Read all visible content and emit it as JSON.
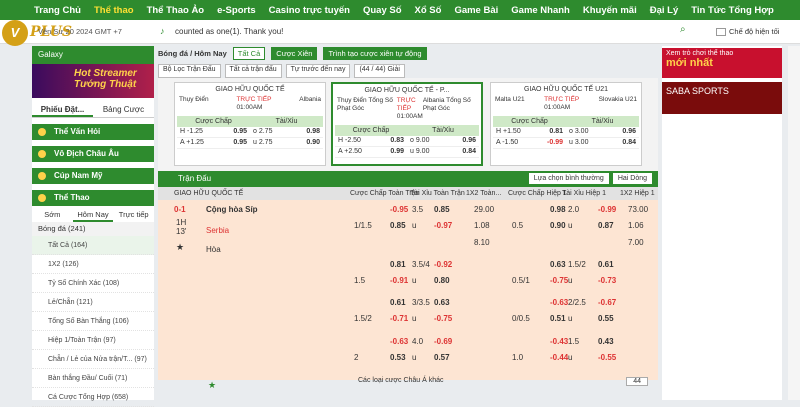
{
  "nav": [
    "Trang Chủ",
    "Thể thao",
    "Thể Thao Ảo",
    "e-Sports",
    "Casino trực tuyến",
    "Quay Số",
    "Xổ Số",
    "Game Bài",
    "Game Nhanh",
    "Khuyến mãi",
    "Đại Lý",
    "Tin Tức Tổng Hợp"
  ],
  "brand": {
    "initials": "V",
    "name": "PLUS"
  },
  "date_text": "Vên Sư 20 2024 GMT +7",
  "ticker": "counted as one(1). Thank you!",
  "toggle_label": "Chế độ hiện tối",
  "left": {
    "galaxy": "Galaxy",
    "banner": [
      "Hot Streamer",
      "Tướng Thuật"
    ],
    "tabs": [
      "Phiếu Đặt...",
      "Bảng Cược"
    ],
    "sections": [
      "Thể Vấn Hỏi",
      "Vô Địch Châu Âu",
      "Cúp Nam Mỹ",
      "Thể Thao"
    ],
    "sport_tabs": [
      "Sớm",
      "Hôm Nay",
      "Trực tiếp"
    ],
    "sport": "Bóng đá (241)",
    "items": [
      "Tất Cả (164)",
      "1X2 (126)",
      "Tỷ Số Chính Xác (108)",
      "Lẻ/Chẵn (121)",
      "Tổng Số Bàn Thắng (106)",
      "Hiệp 1/Toàn Trận (97)",
      "Chẵn / Lẻ của Nửa trận/T... (97)",
      "Bàn thắng Đầu/ Cuối (71)",
      "Cá Cược Tổng Hợp (658)"
    ]
  },
  "crumb": {
    "title": "Bóng đá / Hôm Nay",
    "select": "Tất Cả",
    "btn1": "Cược Xiên",
    "btn2": "Trình tạo cược xiên tự động"
  },
  "filters": [
    "Bộ Lọc Trận Đấu",
    "Tất cả trận đấu",
    "Tự trước đến nay",
    "(44 / 44) Giải"
  ],
  "cards": [
    {
      "league": "GIAO HỮU QUỐC TẾ",
      "home": "Thụy Điển",
      "away": "Albania",
      "live": "TRỰC TIẾP",
      "time": "01:00AM",
      "h": [
        "H -1.25",
        "0.95",
        "o 2.75",
        "0.98"
      ],
      "a": [
        "A +1.25",
        "0.95",
        "u 2.75",
        "0.90"
      ]
    },
    {
      "league": "GIAO HỮU QUỐC TẾ - P...",
      "home": "Thụy Điển Tổng Số Phạt Góc",
      "away": "Albania Tổng Số Phạt Góc",
      "live": "TRỰC TIẾP",
      "time": "01:00AM",
      "h": [
        "H -2.50",
        "0.83",
        "o 9.00",
        "0.96"
      ],
      "a": [
        "A +2.50",
        "0.99",
        "u 9.00",
        "0.84"
      ]
    },
    {
      "league": "GIAO HỮU QUỐC TẾ U21",
      "home": "Malta U21",
      "away": "Slovakia U21",
      "live": "TRỰC TIẾP",
      "time": "01:00AM",
      "h": [
        "H +1.50",
        "0.81",
        "o 3.00",
        "0.96"
      ],
      "a": [
        "A -1.50",
        "-0.99",
        "u 3.00",
        "0.84"
      ]
    }
  ],
  "card_head": [
    "Cược Chấp",
    "Tài/Xỉu"
  ],
  "table": {
    "title": "Trận Đấu",
    "right_btns": [
      "Lựa chọn bình thường",
      "Hai Dòng"
    ],
    "head": [
      "GIAO HỮU QUỐC TẾ",
      "Cược Chấp Toàn Trận",
      "Tài Xỉu Toàn Trận",
      "1X2 Toàn...",
      "Cược Chấp Hiệp 1",
      "Tài Xỉu Hiệp 1",
      "1X2 Hiệp 1"
    ],
    "match": {
      "score": "0-1",
      "time": "1H 13'",
      "home": "Cộng hòa Síp",
      "away": "Serbia",
      "draw": "Hòa"
    },
    "rows": [
      [
        "",
        "-0.95",
        "3.5",
        "0.85",
        "29.00",
        "",
        "0.98",
        "2.0",
        "-0.99",
        "73.00"
      ],
      [
        "1/1.5",
        "0.85",
        "u",
        "-0.97",
        "1.08",
        "0.5",
        "0.90",
        "u",
        "0.87",
        "1.06"
      ],
      [
        "",
        "",
        "",
        "",
        "8.10",
        "",
        "",
        "",
        "",
        "7.00"
      ],
      [
        "",
        "0.81",
        "3.5/4",
        "-0.92",
        "",
        "",
        "0.63",
        "1.5/2",
        "0.61",
        ""
      ],
      [
        "1.5",
        "-0.91",
        "u",
        "0.80",
        "",
        "0.5/1",
        "-0.75",
        "u",
        "-0.73",
        ""
      ],
      [
        "",
        "0.61",
        "3/3.5",
        "0.63",
        "",
        "",
        "-0.63",
        "2/2.5",
        "-0.67",
        ""
      ],
      [
        "1.5/2",
        "-0.71",
        "u",
        "-0.75",
        "",
        "0/0.5",
        "0.51",
        "u",
        "0.55",
        ""
      ],
      [
        "",
        "-0.63",
        "4.0",
        "-0.69",
        "",
        "",
        "-0.43",
        "1.5",
        "0.43",
        ""
      ],
      [
        "2",
        "0.53",
        "u",
        "0.57",
        "",
        "1.0",
        "-0.44",
        "u",
        "-0.55",
        ""
      ]
    ],
    "more": "Các loại cược Châu Á khác",
    "page": "44"
  },
  "right": {
    "ad1_small": "Xem trò chơi thể thao",
    "ad1_big": "mới nhất",
    "ad2": "SABA SPORTS"
  }
}
